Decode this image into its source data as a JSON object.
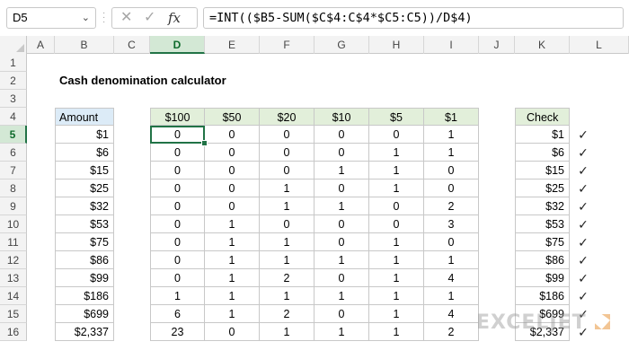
{
  "formula_bar": {
    "name_box": "D5",
    "formula": "=INT(($B5-SUM($C$4:C$4*$C5:C5))/D$4)",
    "cancel_icon": "close-icon",
    "enter_icon": "check-icon",
    "fx_label": "fx"
  },
  "columns": [
    "A",
    "B",
    "C",
    "D",
    "E",
    "F",
    "G",
    "H",
    "I",
    "J",
    "K",
    "L"
  ],
  "rows": [
    "1",
    "2",
    "3",
    "4",
    "5",
    "6",
    "7",
    "8",
    "9",
    "10",
    "11",
    "12",
    "13",
    "14",
    "15",
    "16"
  ],
  "active_cell": "D5",
  "sheet": {
    "title": "Cash denomination calculator",
    "amount_header": "Amount",
    "check_header": "Check",
    "denominations": [
      "$100",
      "$50",
      "$20",
      "$10",
      "$5",
      "$1"
    ],
    "amounts": [
      "$1",
      "$6",
      "$15",
      "$25",
      "$32",
      "$53",
      "$75",
      "$86",
      "$99",
      "$186",
      "$699",
      "$2,337"
    ],
    "counts": [
      [
        "0",
        "0",
        "0",
        "0",
        "0",
        "1"
      ],
      [
        "0",
        "0",
        "0",
        "0",
        "1",
        "1"
      ],
      [
        "0",
        "0",
        "0",
        "1",
        "1",
        "0"
      ],
      [
        "0",
        "0",
        "1",
        "0",
        "1",
        "0"
      ],
      [
        "0",
        "0",
        "1",
        "1",
        "0",
        "2"
      ],
      [
        "0",
        "1",
        "0",
        "0",
        "0",
        "3"
      ],
      [
        "0",
        "1",
        "1",
        "0",
        "1",
        "0"
      ],
      [
        "0",
        "1",
        "1",
        "1",
        "1",
        "1"
      ],
      [
        "0",
        "1",
        "2",
        "0",
        "1",
        "4"
      ],
      [
        "1",
        "1",
        "1",
        "1",
        "1",
        "1"
      ],
      [
        "6",
        "1",
        "2",
        "0",
        "1",
        "4"
      ],
      [
        "23",
        "0",
        "1",
        "1",
        "1",
        "2"
      ]
    ],
    "checks": [
      "$1",
      "$6",
      "$15",
      "$25",
      "$32",
      "$53",
      "$75",
      "$86",
      "$99",
      "$186",
      "$699",
      "$2,337"
    ],
    "check_mark": "✓"
  },
  "watermark": "EXCELJET"
}
